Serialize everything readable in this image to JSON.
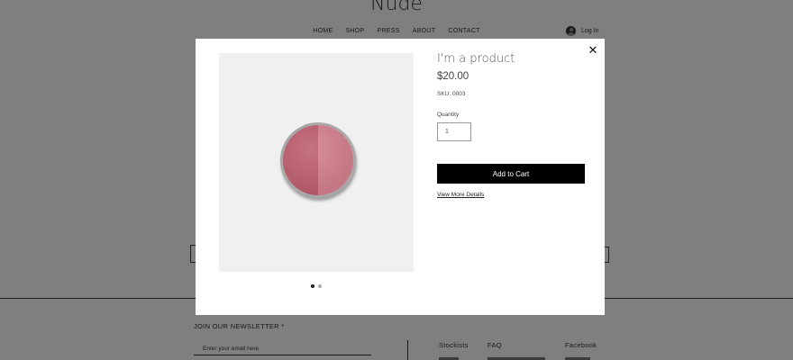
{
  "site": {
    "title": "Nude",
    "nav": [
      "HOME",
      "SHOP",
      "PRESS",
      "ABOUT",
      "CONTACT"
    ],
    "login_label": "Log In"
  },
  "footer": {
    "newsletter_title": "JOIN OUR NEWSLETTER *",
    "newsletter_placeholder": "Enter your email here",
    "links": [
      "Stockists",
      "FAQ",
      "Facebook"
    ]
  },
  "modal": {
    "close_symbol": "✕",
    "product_name": "I'm a product",
    "price": "$20.00",
    "sku": "SKU: 0003",
    "quantity_label": "Quantity",
    "quantity_value": "1",
    "add_to_cart_label": "Add to Cart",
    "view_details_label": "View More Details",
    "image_count": 2,
    "active_image_index": 0
  },
  "colors": {
    "overlay": "rgba(0,0,0,0.5)",
    "button_bg": "#000000",
    "blush_dark": "#bf5f70",
    "blush_light": "#d4808e"
  }
}
